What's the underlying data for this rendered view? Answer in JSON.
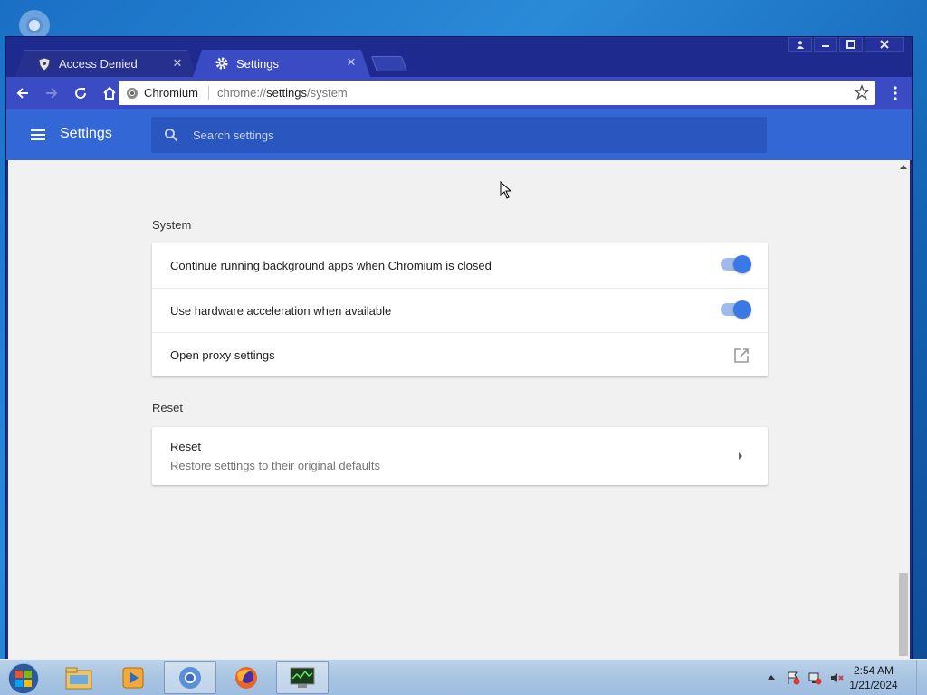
{
  "window": {
    "tabs": [
      {
        "label": "Access Denied",
        "icon": "shield-icon",
        "active": false
      },
      {
        "label": "Settings",
        "icon": "gear-icon",
        "active": true
      }
    ]
  },
  "toolbar": {
    "site_name": "Chromium",
    "url_scheme": "chrome://",
    "url_host": "settings",
    "url_path": "/system"
  },
  "header": {
    "title": "Settings",
    "search_placeholder": "Search settings"
  },
  "sections": {
    "system": {
      "title": "System",
      "rows": [
        {
          "label": "Continue running background apps when Chromium is closed",
          "control": "toggle",
          "on": true
        },
        {
          "label": "Use hardware acceleration when available",
          "control": "toggle",
          "on": true
        },
        {
          "label": "Open proxy settings",
          "control": "external-link-icon"
        }
      ]
    },
    "reset": {
      "title": "Reset",
      "row": {
        "label": "Reset",
        "sublabel": "Restore settings to their original defaults"
      }
    }
  },
  "taskbar": {
    "items": [
      "start-orb-icon",
      "file-explorer-icon",
      "media-player-icon",
      "chromium-icon",
      "firefox-icon",
      "task-manager-icon"
    ],
    "time": "2:54 AM",
    "date": "1/21/2024"
  },
  "colors": {
    "frame": "#1f2a8f",
    "toolbar": "#3a4bc4",
    "header": "#3367d6",
    "toggle_on": "#3a78e6",
    "content_bg": "#f1f1f1"
  }
}
